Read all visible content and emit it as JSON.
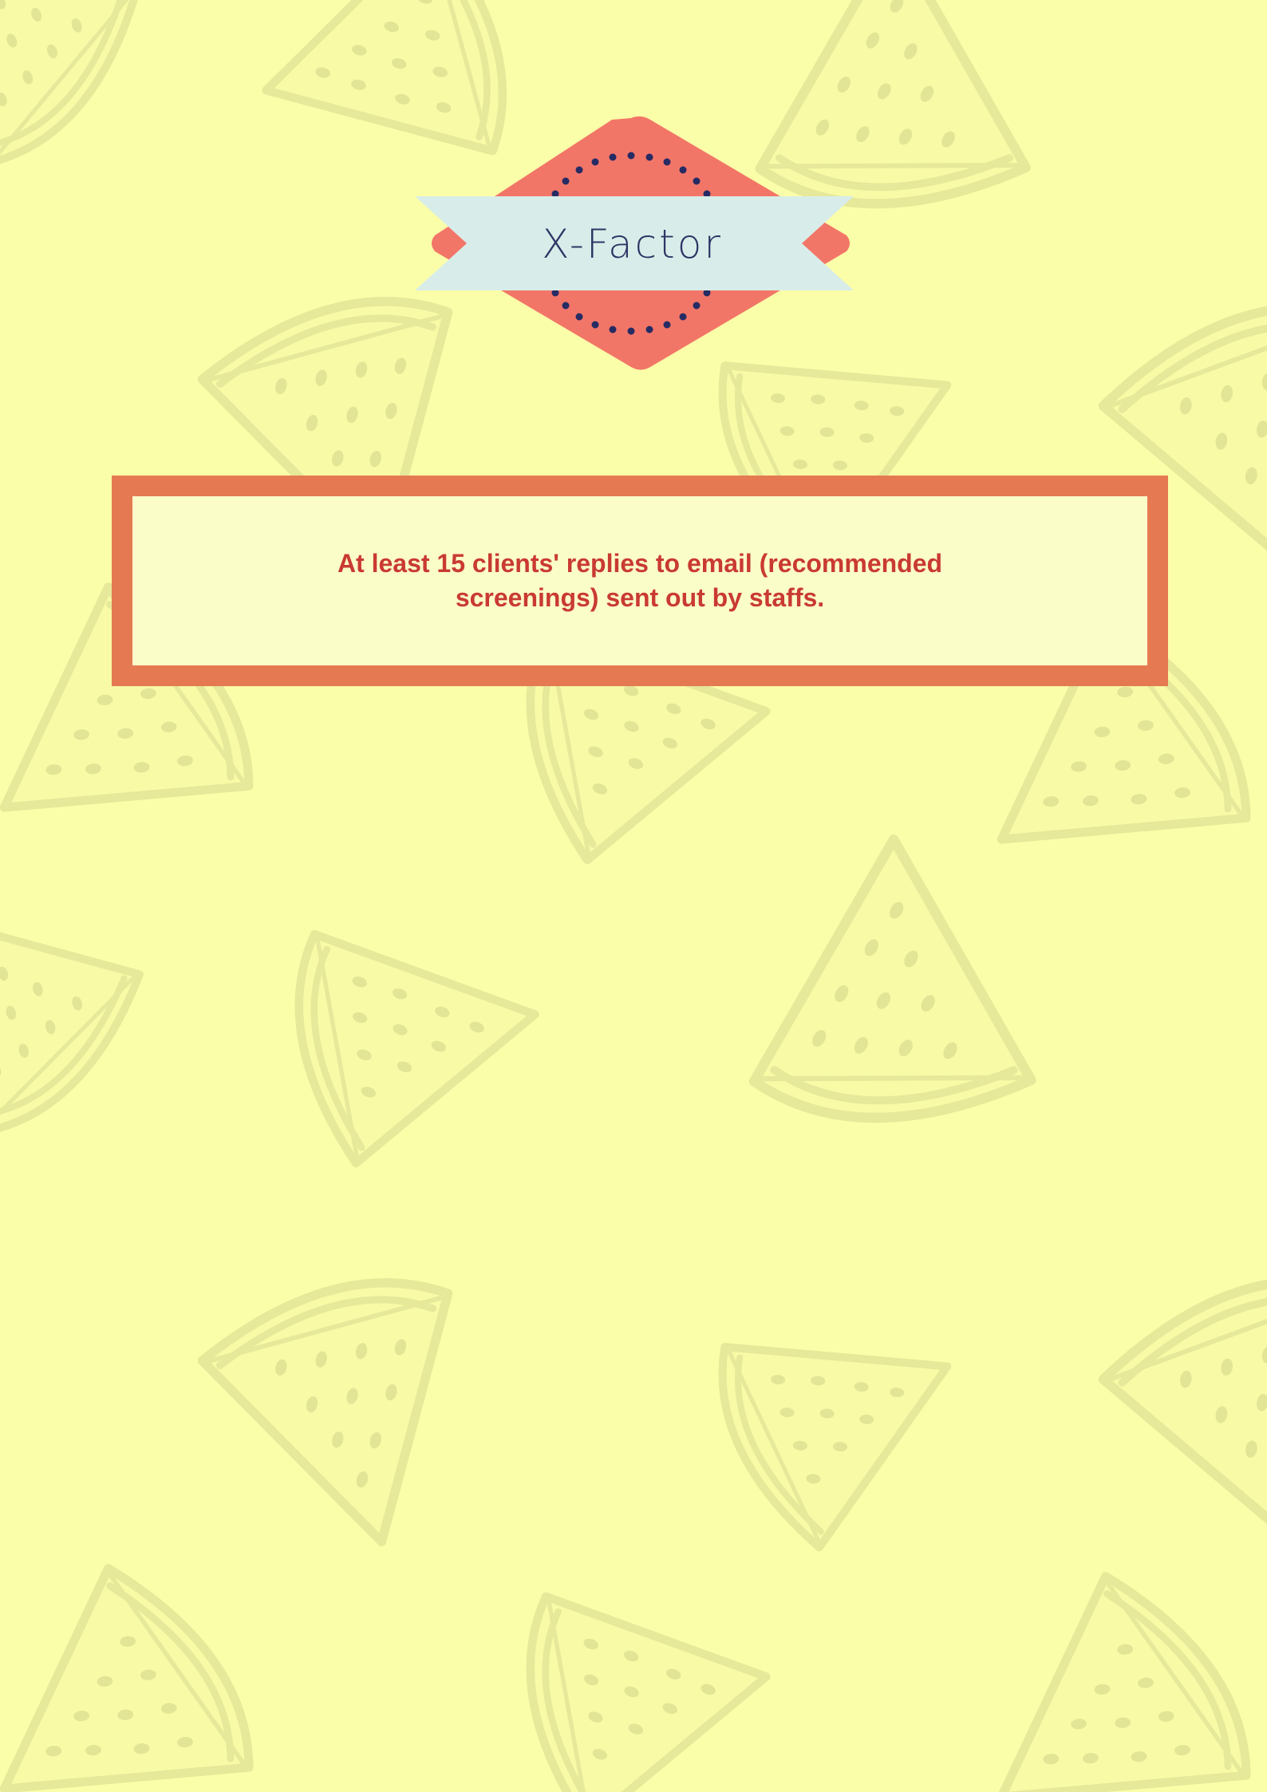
{
  "badge": {
    "title": "X-Factor",
    "colors": {
      "diamond": "#f27668",
      "ribbon": "#d8ede9",
      "dots": "#262b63",
      "text": "#2e3566"
    }
  },
  "note": {
    "text": "At least 15 clients' replies to email (recommended screenings) sent out by staffs.",
    "colors": {
      "frame": "#e57a52",
      "fill": "#fbfdc9",
      "text": "#c93a32"
    }
  },
  "background": {
    "color": "#fbfea8",
    "pattern_icon": "watermelon-slice-icon"
  }
}
